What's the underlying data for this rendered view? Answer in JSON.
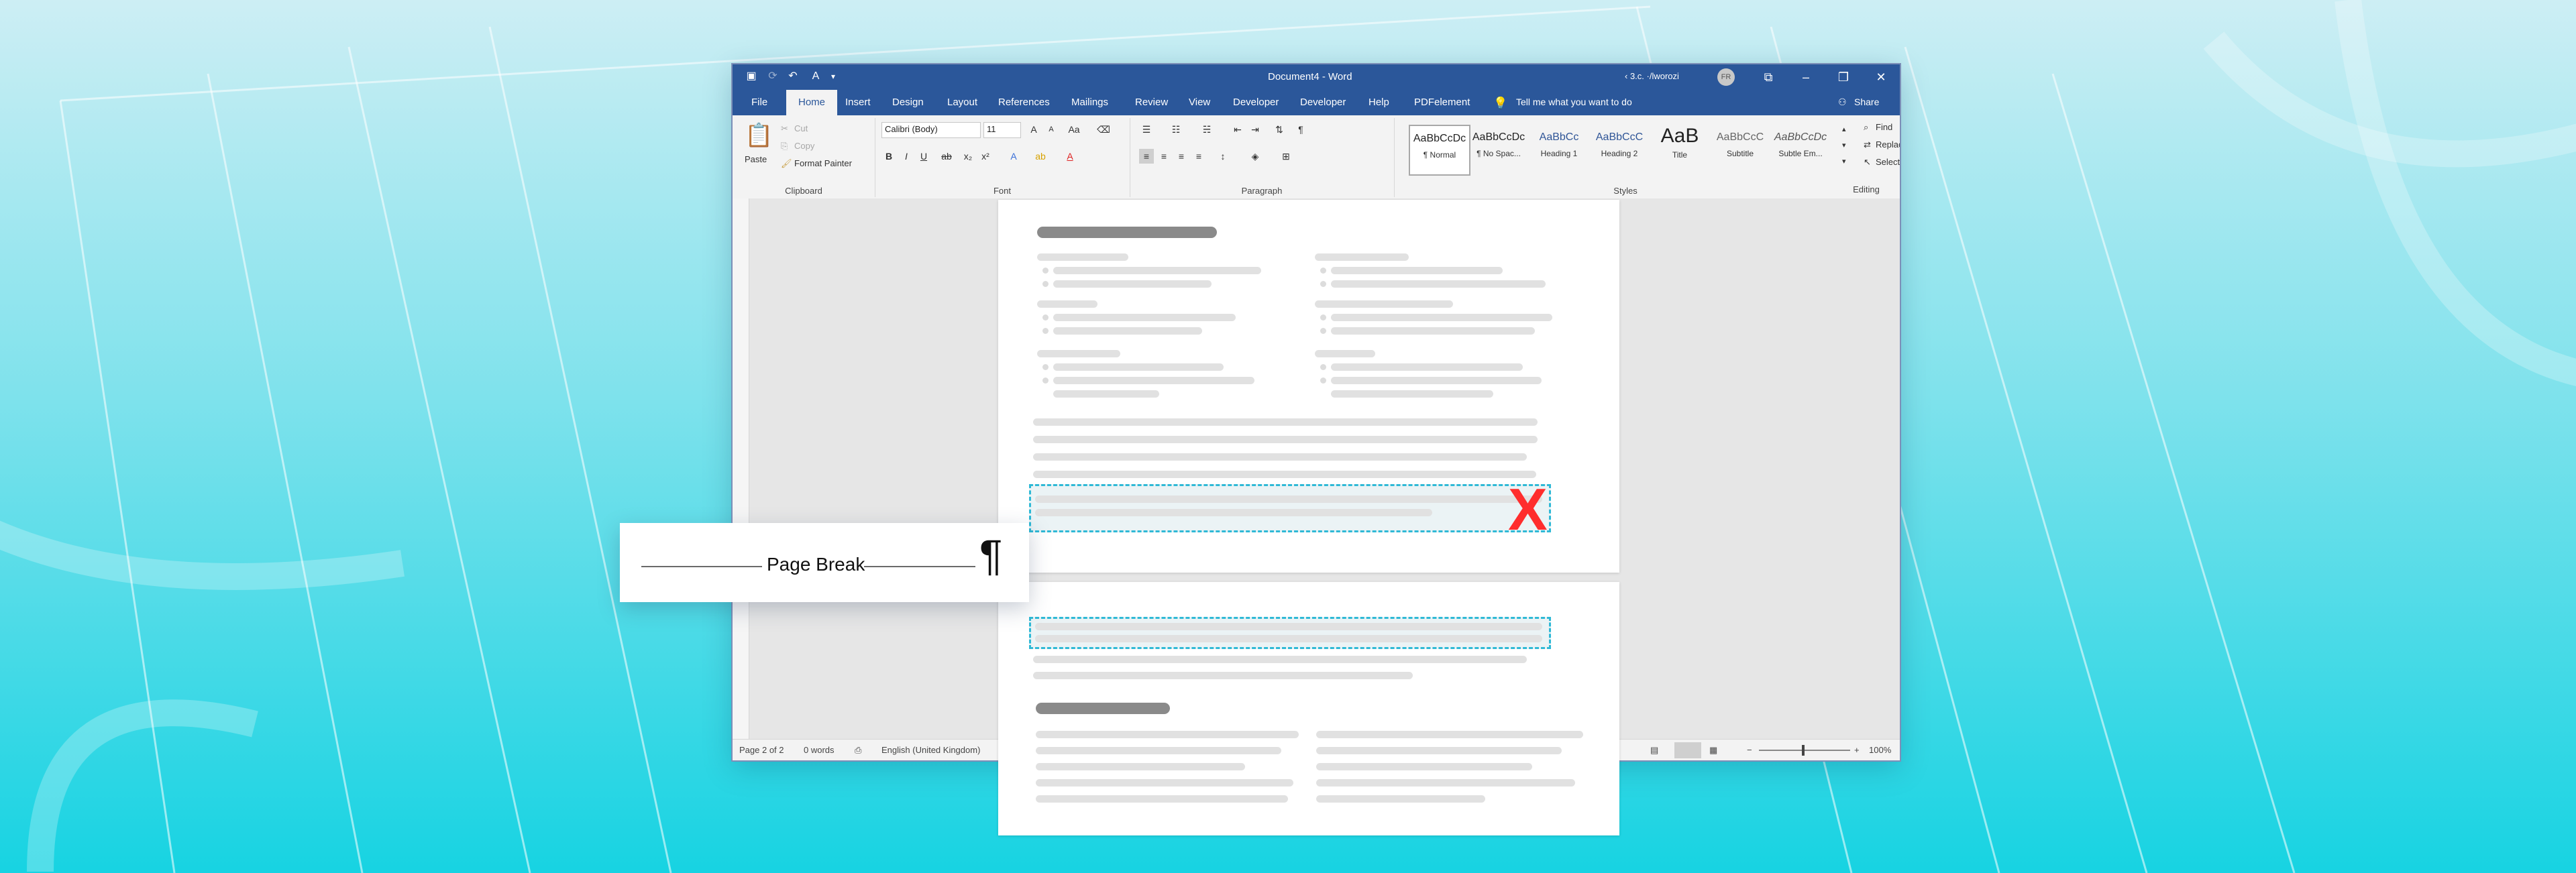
{
  "window": {
    "title": "Document4 - Word",
    "user": "‹ 3.c. ·/lworozi",
    "user_initials": "FR"
  },
  "tabs": [
    "File",
    "Home",
    "Insert",
    "Design",
    "Layout",
    "References",
    "Mailings",
    "Review",
    "View",
    "Developer",
    "Developer",
    "Help",
    "PDFelement"
  ],
  "active_tab": "Home",
  "tell_me": "Tell me what you want to do",
  "share": "Share",
  "ribbon": {
    "clipboard": {
      "label": "Clipboard",
      "paste": "Paste",
      "cut": "Cut",
      "copy": "Copy",
      "format_painter": "Format Painter"
    },
    "font": {
      "label": "Font",
      "font_name": "Calibri (Body)",
      "font_size": "11"
    },
    "paragraph": {
      "label": "Paragraph"
    },
    "styles": {
      "label": "Styles",
      "items": [
        {
          "sample": "AaBbCcDc",
          "name": "¶ Normal"
        },
        {
          "sample": "AaBbCcDc",
          "name": "¶ No Spac..."
        },
        {
          "sample": "AaBbCc",
          "name": "Heading 1"
        },
        {
          "sample": "AaBbCcC",
          "name": "Heading 2"
        },
        {
          "sample": "AaB",
          "name": "Title"
        },
        {
          "sample": "AaBbCcC",
          "name": "Subtitle"
        },
        {
          "sample": "AaBbCcDc",
          "name": "Subtle Em..."
        }
      ]
    },
    "editing": {
      "label": "Editing",
      "find": "Find",
      "replace": "Replace",
      "select": "Select"
    }
  },
  "status": {
    "page": "Page 2 of 2",
    "words": "0 words",
    "language": "English (United Kingdom)",
    "zoom": "100%"
  },
  "page_break": {
    "label": "Page Break",
    "symbol": "¶"
  },
  "marker": "X",
  "colors": {
    "word_blue": "#2b579a",
    "highlight": "#2fb9d6",
    "mark_red": "#ff2d2d"
  }
}
